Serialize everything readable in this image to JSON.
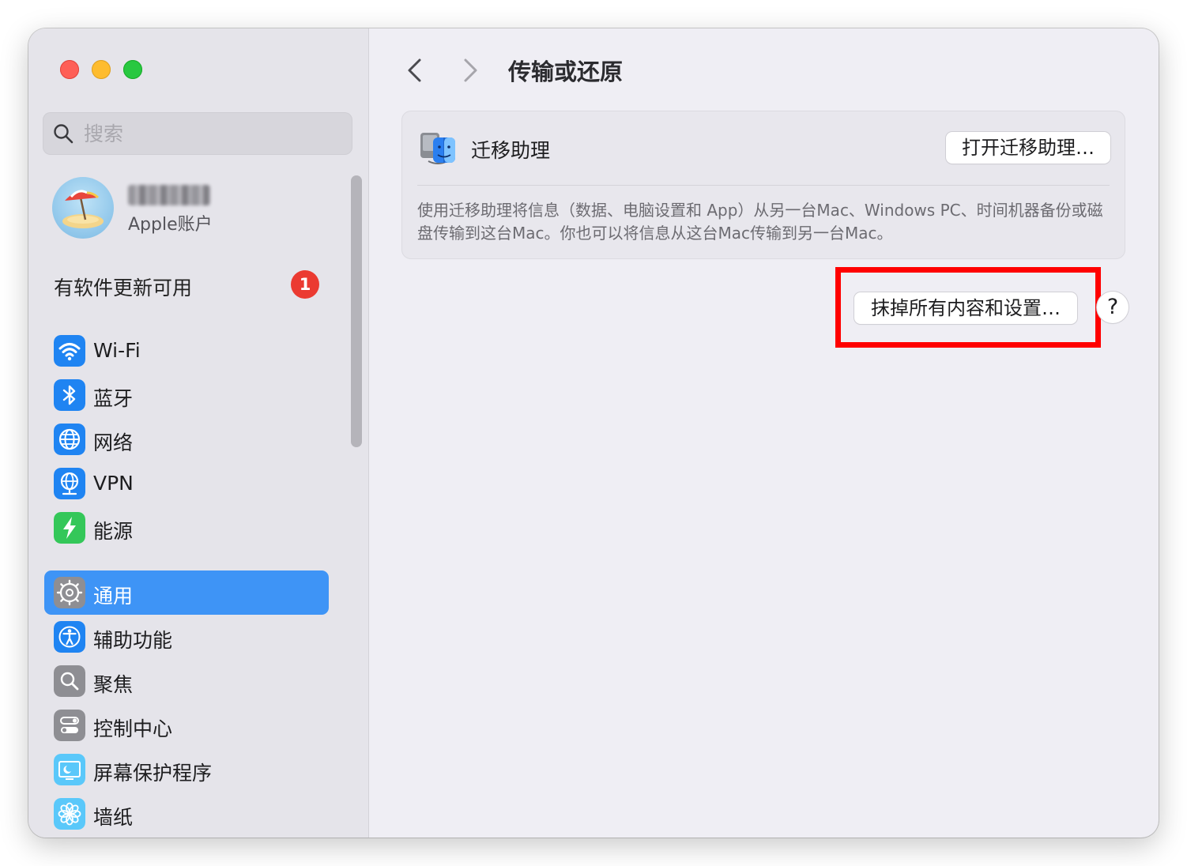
{
  "window": {
    "traffic_lights": [
      "close",
      "minimize",
      "zoom"
    ]
  },
  "sidebar": {
    "search": {
      "placeholder": "搜索",
      "value": ""
    },
    "account": {
      "subtitle": "Apple账户"
    },
    "update": {
      "label": "有软件更新可用",
      "badge": "1"
    },
    "items": [
      {
        "label": "Wi-Fi",
        "icon": "wifi-icon",
        "color": "#1f84f2",
        "selected": false
      },
      {
        "label": "蓝牙",
        "icon": "bluetooth-icon",
        "color": "#1f84f2",
        "selected": false
      },
      {
        "label": "网络",
        "icon": "globe-icon",
        "color": "#1f84f2",
        "selected": false
      },
      {
        "label": "VPN",
        "icon": "vpn-globe-icon",
        "color": "#1f84f2",
        "selected": false
      },
      {
        "label": "能源",
        "icon": "bolt-icon",
        "color": "#34c759",
        "selected": false
      },
      {
        "label": "通用",
        "icon": "gear-icon",
        "color": "#8e8e93",
        "selected": true
      },
      {
        "label": "辅助功能",
        "icon": "accessibility-icon",
        "color": "#1f84f2",
        "selected": false
      },
      {
        "label": "聚焦",
        "icon": "magnifier-icon",
        "color": "#8e8e93",
        "selected": false
      },
      {
        "label": "控制中心",
        "icon": "control-center-icon",
        "color": "#8e8e93",
        "selected": false
      },
      {
        "label": "屏幕保护程序",
        "icon": "screensaver-icon",
        "color": "#5ac8fa",
        "selected": false
      },
      {
        "label": "墙纸",
        "icon": "flower-icon",
        "color": "#5ac8fa",
        "selected": false
      }
    ],
    "selection_color": "#3e94f6"
  },
  "main": {
    "title": "传输或还原",
    "migration": {
      "title": "迁移助理",
      "button": "打开迁移助理…",
      "description": "使用迁移助理将信息（数据、电脑设置和 App）从另一台Mac、Windows PC、时间机器备份或磁盘传输到这台Mac。你也可以将信息从这台Mac传输到另一台Mac。"
    },
    "erase_button": "抹掉所有内容和设置…",
    "help_button": "?",
    "highlight_color": "#ff0000"
  }
}
